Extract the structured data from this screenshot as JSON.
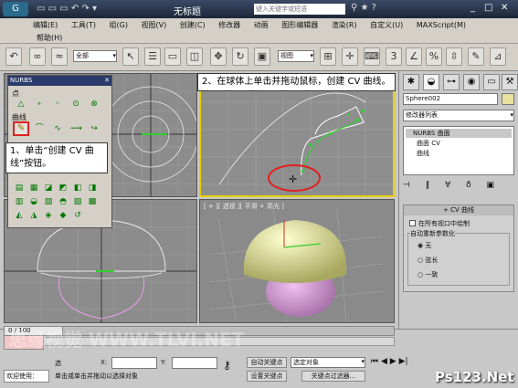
{
  "titlebar": {
    "title": "无标题",
    "search_placeholder": "键入关键字或短语"
  },
  "menu": {
    "row1": [
      "编辑(E)",
      "工具(T)",
      "组(G)",
      "视图(V)",
      "创建(C)",
      "修改器",
      "动画",
      "图形编辑器",
      "渲染(R)",
      "自定义(U)",
      "MAXScript(M)"
    ],
    "row2": [
      "帮助(H)"
    ]
  },
  "toolbar": {
    "selection_filter": "全部",
    "view_dropdown": "视图"
  },
  "viewports": {
    "perspective_label": "[ + ][ 透视 ][ 平滑 + 高光 ]"
  },
  "nurbs": {
    "title": "NURBS",
    "section_point": "点",
    "section_curve": "曲线"
  },
  "callouts": {
    "step1": "1、单击“创建 CV 曲线”按钮。",
    "step2": "2、在球体上单击并拖动鼠标，创建 CV 曲线。"
  },
  "cmdpanel": {
    "object_name": "Sphere002",
    "modifier_list": "修改器列表",
    "stack": [
      "NURBS 曲面",
      "曲面 CV",
      "曲线"
    ],
    "rollout_title": "CV 曲线",
    "draw_all_label": "在所有视口中绘制",
    "reparam_label": "自动重新参数化",
    "options": [
      "无",
      "弦长",
      "一致"
    ],
    "selected_option": 0
  },
  "timeline": {
    "frame": "0 / 100"
  },
  "statusbar": {
    "welcome": "欢迎使用：",
    "prompt": "单击或单击并拖动以选择对象",
    "select_label": "选",
    "x_label": "X:",
    "y_label": "Y:",
    "autokey": "自动关键点",
    "setkey": "设置关键点",
    "key_filter": "关键点过滤器...",
    "selected_obj": "选定对象"
  },
  "watermark": {
    "text": "思缘视觉 WWW.TLVI.NET",
    "site": "Ps123.Net"
  },
  "colors": {
    "accent": "#e8d000",
    "callout_ring": "#e02020",
    "curve": "#30d030"
  }
}
